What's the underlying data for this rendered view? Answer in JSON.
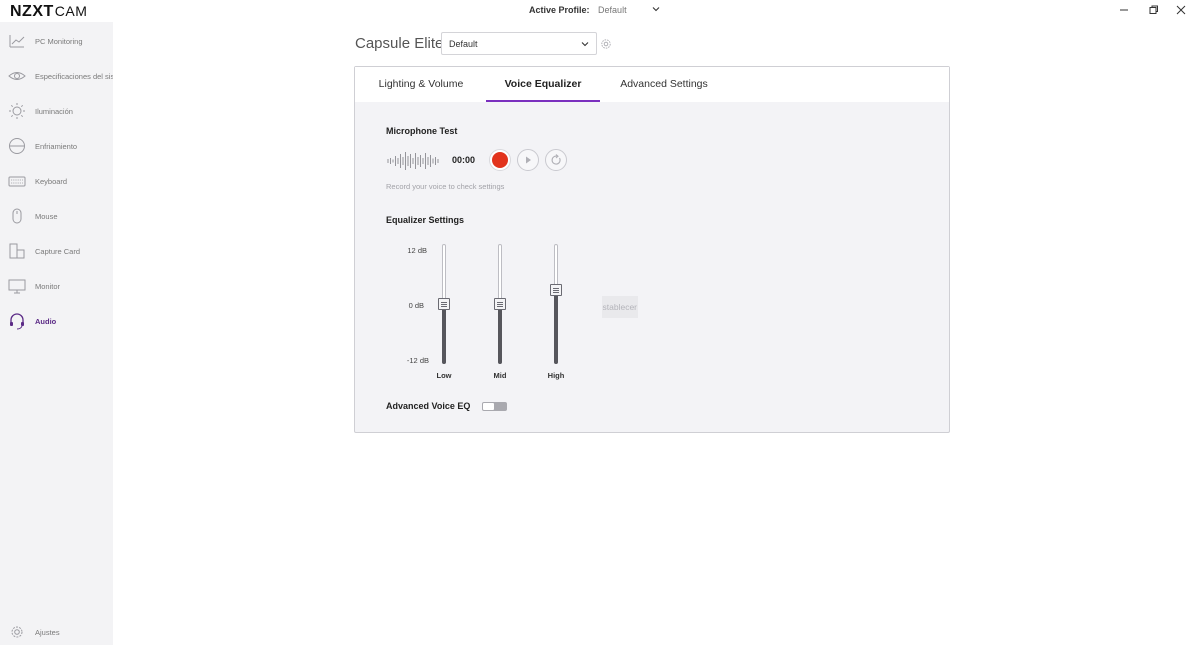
{
  "app": {
    "logo_main": "NZXT",
    "logo_sub": "CAM"
  },
  "titlebar": {
    "active_profile_label": "Active Profile:",
    "active_profile_value": "Default"
  },
  "sidebar": {
    "items": [
      {
        "label": "PC Monitoring",
        "icon": "chart-line-icon"
      },
      {
        "label": "Especificaciones del sis",
        "icon": "eye-icon"
      },
      {
        "label": "Iluminación",
        "icon": "sun-icon"
      },
      {
        "label": "Enfriamiento",
        "icon": "fan-icon"
      },
      {
        "label": "Keyboard",
        "icon": "keyboard-icon"
      },
      {
        "label": "Mouse",
        "icon": "mouse-icon"
      },
      {
        "label": "Capture Card",
        "icon": "capture-card-icon"
      },
      {
        "label": "Monitor",
        "icon": "monitor-icon"
      },
      {
        "label": "Audio",
        "icon": "headset-icon",
        "active": true
      }
    ],
    "settings_label": "Ajustes"
  },
  "header": {
    "device_name": "Capsule Elite",
    "profile_value": "Default"
  },
  "tabs": [
    {
      "label": "Lighting & Volume"
    },
    {
      "label": "Voice Equalizer",
      "active": true
    },
    {
      "label": "Advanced Settings"
    }
  ],
  "mic_test": {
    "title": "Microphone Test",
    "timer": "00:00",
    "hint": "Record your voice to check settings"
  },
  "equalizer": {
    "title": "Equalizer Settings",
    "db_labels": {
      "top": "12 dB",
      "mid": "0 dB",
      "bottom": "-12 dB"
    },
    "range_db": [
      -12,
      12
    ],
    "bands": [
      {
        "label": "Low",
        "value_db": 0
      },
      {
        "label": "Mid",
        "value_db": 0
      },
      {
        "label": "High",
        "value_db": 3
      }
    ],
    "reset_label": "Restablecer"
  },
  "advanced_eq": {
    "label": "Advanced Voice EQ",
    "enabled": false
  },
  "colors": {
    "accent": "#7a2fbe",
    "record": "#e2341d",
    "sidebar_active": "#5b2a86"
  }
}
